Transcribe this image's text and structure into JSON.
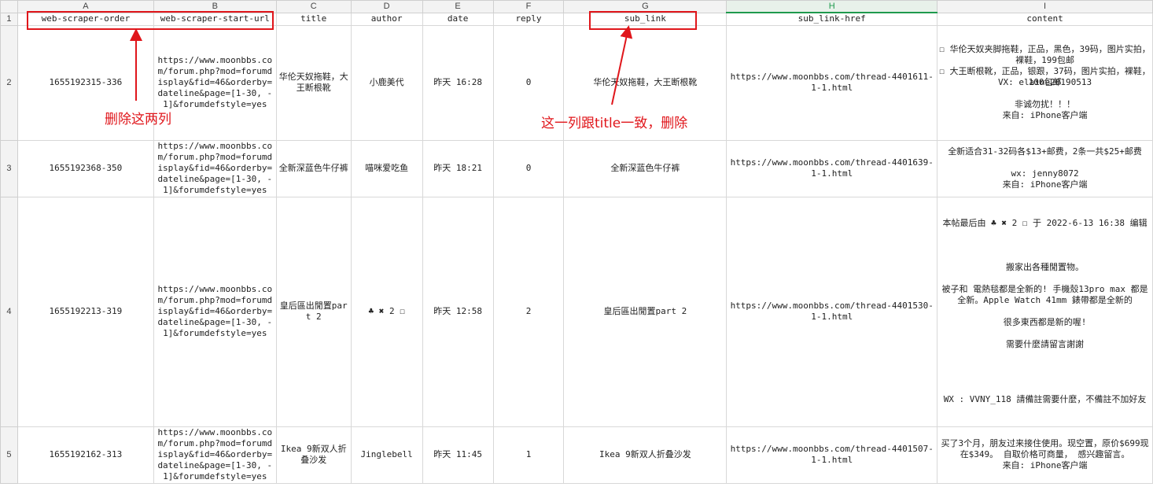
{
  "columns": [
    "A",
    "B",
    "C",
    "D",
    "E",
    "F",
    "G",
    "H",
    "I"
  ],
  "header_row": {
    "num": "1",
    "cells": [
      "web-scraper-order",
      "web-scraper-start-url",
      "title",
      "author",
      "date",
      "reply",
      "sub_link",
      "sub_link-href",
      "content"
    ]
  },
  "rows": [
    {
      "num": "2",
      "order": "1655192315-336",
      "url": "https://www.moonbbs.com/forum.php?mod=forumdisplay&fid=46&orderby=dateline&page=[1-30, -1]&forumdefstyle=yes",
      "title": "华伦天奴拖鞋，大王断根靴",
      "author": "小鹿美代",
      "date": "昨天  16:28",
      "reply": "0",
      "sub_link": "华伦天奴拖鞋，大王断根靴",
      "href": "https://www.moonbbs.com/thread-4401611-1-1.html",
      "content": [
        "☐ 华伦天奴夹脚拖鞋，正品，黑色，39码，图片实拍，裸鞋，199包邮",
        "☐ 大王断根靴，正品，银跟，37码，图片实拍，裸鞋，100包邮",
        "",
        "VX: elaine20190513",
        "",
        "非诚勿扰！！！",
        "来自: iPhone客户端"
      ]
    },
    {
      "num": "3",
      "order": "1655192368-350",
      "url": "https://www.moonbbs.com/forum.php?mod=forumdisplay&fid=46&orderby=dateline&page=[1-30, -1]&forumdefstyle=yes",
      "title": "全新深蓝色牛仔裤",
      "author": "喵咪爱吃鱼",
      "date": "昨天  18:21",
      "reply": "0",
      "sub_link": "全新深蓝色牛仔裤",
      "href": "https://www.moonbbs.com/thread-4401639-1-1.html",
      "content": [
        "全新适合31-32码各$13+邮费，2条一共$25+邮费",
        "",
        "wx: jenny8072",
        "来自: iPhone客户端"
      ]
    },
    {
      "num": "4",
      "order": "1655192213-319",
      "url": "https://www.moonbbs.com/forum.php?mod=forumdisplay&fid=46&orderby=dateline&page=[1-30, -1]&forumdefstyle=yes",
      "title": "皇后區出閒置part 2",
      "author": "♣ ✖  2 ☐",
      "date": "昨天  12:58",
      "reply": "2",
      "sub_link": "皇后區出閒置part 2",
      "href": "https://www.moonbbs.com/thread-4401530-1-1.html",
      "content": [
        "本帖最后由 ♣ ✖  2 ☐  于 2022-6-13 16:38 编辑",
        "",
        "",
        "",
        "搬家出各種閒置物。",
        "",
        "被子和 電熱毯都是全新的! 手機殼13pro max 都是全新。Apple Watch 41mm 錶帶都是全新的",
        "",
        "很多東西都是新的喔!",
        "",
        "需要什麼請留言謝謝",
        "",
        "",
        "",
        "",
        "WX : VVNY_118    請備註需要什麼，不備註不加好友"
      ]
    },
    {
      "num": "5",
      "order": "1655192162-313",
      "url": "https://www.moonbbs.com/forum.php?mod=forumdisplay&fid=46&orderby=dateline&page=[1-30, -1]&forumdefstyle=yes",
      "title": "Ikea 9新双人折叠沙发",
      "author": "Jinglebell",
      "date": "昨天  11:45",
      "reply": "1",
      "sub_link": "Ikea 9新双人折叠沙发",
      "href": "https://www.moonbbs.com/thread-4401507-1-1.html",
      "content": [
        "买了3个月，朋友过来接住使用。现空置，原价$699现在$349。 自取价格可商量， 感兴趣留言。",
        "来自: iPhone客户端"
      ]
    }
  ],
  "annotations": {
    "left_note": "删除这两列",
    "right_note": "这一列跟title一致，删除",
    "color": "#e0161b"
  },
  "colors": {
    "selected_column": "#1f9a4d",
    "grid": "#d8d8d8",
    "header_bg": "#f3f3f3"
  }
}
